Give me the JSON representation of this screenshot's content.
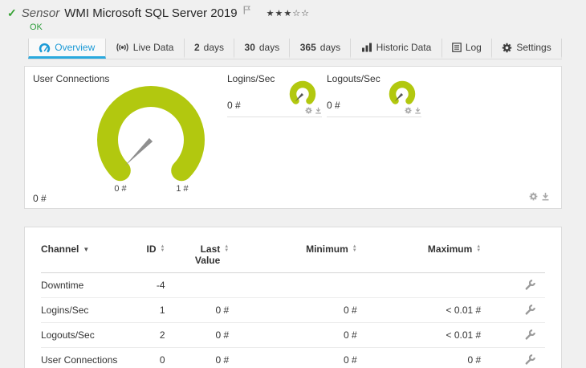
{
  "colors": {
    "gauge_green": "#b2c80f",
    "status_ok_green": "#2f9e3d",
    "tab_active_blue": "#1c9ad6",
    "needle_gray": "#8f8f8f"
  },
  "icons": {
    "check": "✓",
    "sort_asc": "▲",
    "sort_desc": "▼",
    "sort_active": "▼"
  },
  "header": {
    "kind": "Sensor",
    "title": "WMI Microsoft SQL Server 2019",
    "stars_filled": "★★★",
    "stars_empty": "☆☆",
    "status": "OK"
  },
  "tabs": [
    {
      "label": "Overview"
    },
    {
      "label": "Live Data"
    },
    {
      "num": "2",
      "label": "days"
    },
    {
      "num": "30",
      "label": "days"
    },
    {
      "num": "365",
      "label": "days"
    },
    {
      "label": "Historic Data"
    },
    {
      "label": "Log"
    },
    {
      "label": "Settings"
    }
  ],
  "gauge_panel": {
    "user_connections": {
      "title": "User Connections",
      "value": "0 #",
      "scale_min": "0 #",
      "scale_max": "1 #"
    },
    "logins_sec": {
      "title": "Logins/Sec",
      "value": "0 #"
    },
    "logouts_sec": {
      "title": "Logouts/Sec",
      "value": "0 #"
    }
  },
  "table": {
    "headers": {
      "channel": "Channel",
      "id": "ID",
      "last_value": "Last Value",
      "minimum": "Minimum",
      "maximum": "Maximum"
    },
    "rows": [
      {
        "channel": "Downtime",
        "id": "-4",
        "last": "",
        "min": "",
        "max": ""
      },
      {
        "channel": "Logins/Sec",
        "id": "1",
        "last": "0 #",
        "min": "0 #",
        "max": "< 0.01 #"
      },
      {
        "channel": "Logouts/Sec",
        "id": "2",
        "last": "0 #",
        "min": "0 #",
        "max": "< 0.01 #"
      },
      {
        "channel": "User Connections",
        "id": "0",
        "last": "0 #",
        "min": "0 #",
        "max": "0 #"
      }
    ]
  }
}
